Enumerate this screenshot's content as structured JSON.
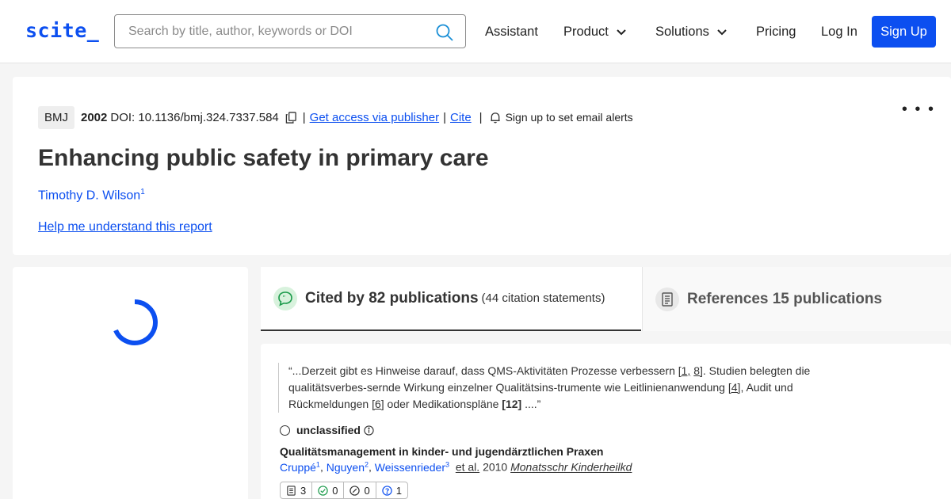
{
  "header": {
    "logo": "scite_",
    "search_placeholder": "Search by title, author, keywords or DOI",
    "nav": {
      "assistant": "Assistant",
      "product": "Product",
      "solutions": "Solutions",
      "pricing": "Pricing",
      "login": "Log In",
      "signup": "Sign Up"
    }
  },
  "article": {
    "journal": "BMJ",
    "year": "2002",
    "doi": "DOI: 10.1136/bmj.324.7337.584",
    "access_link": "Get access via publisher",
    "cite_link": "Cite",
    "alerts": "Sign up to set email alerts",
    "more": "• • •",
    "title": "Enhancing public safety in primary care",
    "author": "Timothy D. Wilson",
    "author_sup": "1",
    "help_link": "Help me understand this report"
  },
  "tabs": {
    "cited_label": "Cited by 82 publications",
    "cited_sub": "(44 citation statements)",
    "refs_label": "References 15 publications"
  },
  "citation": {
    "quote_1": "“...Derzeit gibt es Hinweise darauf, dass QMS-Aktivitäten Prozesse verbessern ",
    "ref_1": "[1,",
    "ref_8": "8]",
    "quote_2": ". Studien belegten die qualitätsverbes-sernde Wirkung einzelner Qualitätsins-trumente wie Leitlinienanwendung ",
    "ref_4": "[4]",
    "quote_3": ", Audit und Rückmeldungen ",
    "ref_6": "[6]",
    "quote_4": " oder Medikationspläne ",
    "ref_12": "[12]",
    "quote_5": " ....”",
    "classification": "unclassified",
    "pub_title": "Qualitätsmanagement in kinder- und jugendärztlichen Praxen",
    "authors": [
      {
        "name": "Cruppé",
        "sup": "1"
      },
      {
        "name": "Nguyen",
        "sup": "2"
      },
      {
        "name": "Weissenrieder",
        "sup": "3"
      }
    ],
    "etal": "et al.",
    "pub_year": "2010",
    "pub_journal": "Monatsschr Kinderheilkd",
    "stats": {
      "mentions": "3",
      "supporting": "0",
      "contrasting": "0",
      "unclassified": "1"
    }
  },
  "colors": {
    "brand": "#0c4ff0",
    "supporting": "#1a9a4a",
    "cited_icon_bg": "#d8f2dd"
  }
}
